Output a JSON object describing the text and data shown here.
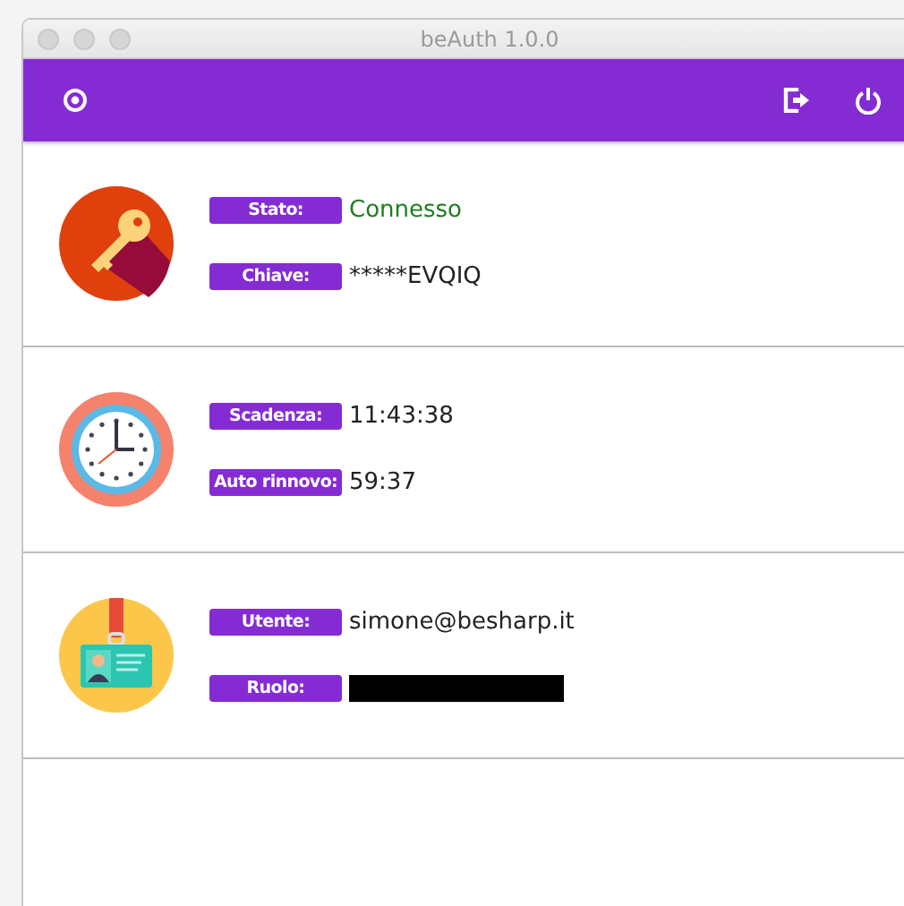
{
  "window": {
    "title": "beAuth 1.0.0"
  },
  "sections": [
    {
      "kind": "key",
      "fields": [
        {
          "label": "Stato:",
          "kind": "text",
          "value": "Connesso",
          "color": "#1e7d1e"
        },
        {
          "label": "Chiave:",
          "kind": "text",
          "value": "*****EVQIQ"
        }
      ]
    },
    {
      "kind": "clock",
      "fields": [
        {
          "label": "Scadenza:",
          "kind": "text",
          "value": "11:43:38"
        },
        {
          "label": "Auto rinnovo:",
          "kind": "text",
          "value": "59:37"
        }
      ]
    },
    {
      "kind": "badge",
      "fields": [
        {
          "label": "Utente:",
          "kind": "text",
          "value": "simone@besharp.it"
        },
        {
          "label": "Ruolo:",
          "kind": "redacted"
        }
      ]
    }
  ]
}
